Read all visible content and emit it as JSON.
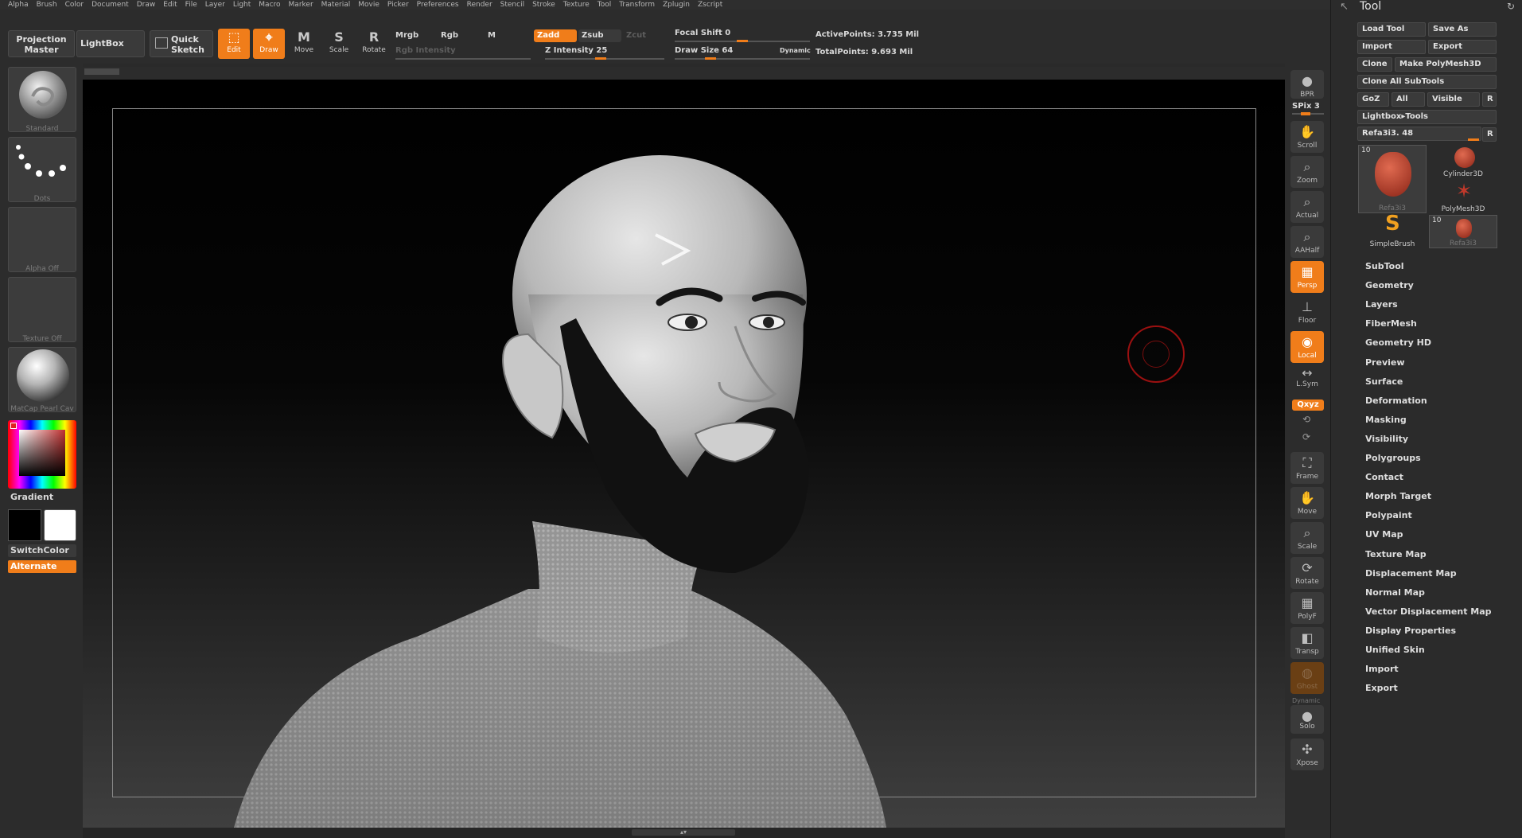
{
  "menu": [
    "Alpha",
    "Brush",
    "Color",
    "Document",
    "Draw",
    "Edit",
    "File",
    "Layer",
    "Light",
    "Macro",
    "Marker",
    "Material",
    "Movie",
    "Picker",
    "Preferences",
    "Render",
    "Stencil",
    "Stroke",
    "Texture",
    "Tool",
    "Transform",
    "Zplugin",
    "Zscript"
  ],
  "toolbar": {
    "projection_master": "Projection Master",
    "lightbox": "LightBox",
    "quick_sketch": "Quick Sketch",
    "modes": [
      {
        "label": "Edit",
        "icon": "edit-icon",
        "active": true
      },
      {
        "label": "Draw",
        "icon": "draw-icon",
        "active": true
      },
      {
        "label": "Move",
        "icon": "move-icon",
        "active": false
      },
      {
        "label": "Scale",
        "icon": "scale-icon",
        "active": false
      },
      {
        "label": "Rotate",
        "icon": "rotate-icon",
        "active": false
      }
    ],
    "mrgb": "Mrgb",
    "rgb": "Rgb",
    "m": "M",
    "rgb_intensity": "Rgb Intensity",
    "zadd": "Zadd",
    "zsub": "Zsub",
    "zcut": "Zcut",
    "z_intensity_label": "Z Intensity",
    "z_intensity": "25",
    "focal_shift_label": "Focal Shift",
    "focal_shift": "0",
    "draw_size_label": "Draw Size",
    "draw_size": "64",
    "dynamic": "Dynamic",
    "active_points_label": "ActivePoints:",
    "active_points": "3.735 Mil",
    "total_points_label": "TotalPoints:",
    "total_points": "9.693 Mil"
  },
  "left": {
    "brush": "Standard",
    "stroke": "Dots",
    "alpha": "Alpha Off",
    "texture": "Texture Off",
    "material": "MatCap Pearl Cav",
    "gradient": "Gradient",
    "switch_color": "SwitchColor",
    "alternate": "Alternate",
    "accent": "#f07d1a"
  },
  "right": {
    "bpr": "BPR",
    "spix_label": "SPix",
    "spix": "3",
    "tools": [
      "Scroll",
      "Zoom",
      "Actual",
      "AAHalf",
      "Persp",
      "Floor",
      "Local",
      "L.Sym",
      "Frame",
      "Move",
      "Scale",
      "Rotate",
      "PolyF",
      "Transp",
      "Ghost",
      "Solo",
      "Xpose"
    ],
    "xyz": "Qxyz",
    "dynamic": "Dynamic"
  },
  "tool_panel": {
    "title": "Tool",
    "load_tool": "Load Tool",
    "save_as": "Save As",
    "import": "Import",
    "export": "Export",
    "clone": "Clone",
    "make_polymesh": "Make PolyMesh3D",
    "clone_all": "Clone All SubTools",
    "goz": "GoZ",
    "all": "All",
    "visible": "Visible",
    "r": "R",
    "lightbox_tools": "Lightbox▸Tools",
    "current_tool": "Refa3i3. 48",
    "tools": [
      {
        "name": "Refa3i3",
        "count": "10"
      },
      {
        "name": "Cylinder3D",
        "count": ""
      },
      {
        "name": "PolyMesh3D",
        "count": ""
      },
      {
        "name": "SimpleBrush",
        "count": ""
      },
      {
        "name": "Refa3i3",
        "count": "10"
      }
    ],
    "sections": [
      "SubTool",
      "Geometry",
      "Layers",
      "FiberMesh",
      "Geometry HD",
      "Preview",
      "Surface",
      "Deformation",
      "Masking",
      "Visibility",
      "Polygroups",
      "Contact",
      "Morph Target",
      "Polypaint",
      "UV Map",
      "Texture Map",
      "Displacement Map",
      "Normal Map",
      "Vector Displacement Map",
      "Display Properties",
      "Unified Skin",
      "Import",
      "Export"
    ]
  }
}
